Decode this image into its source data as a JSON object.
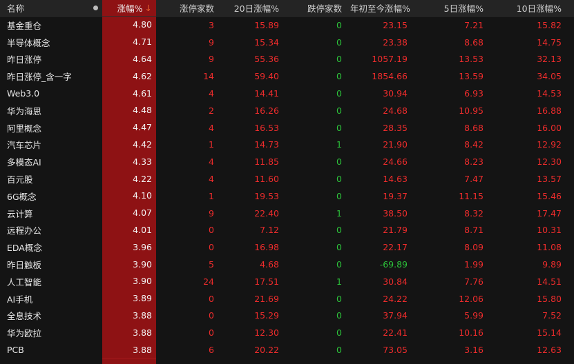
{
  "header": {
    "name": "名称",
    "change_pct": "涨幅%",
    "sort_indicator": "↓",
    "limit_up_count": "涨停家数",
    "change_20d": "20日涨幅%",
    "limit_down_count": "跌停家数",
    "change_ytd": "年初至今涨幅%",
    "change_5d": "5日涨幅%",
    "change_10d": "10日涨幅%"
  },
  "colors": {
    "up": "#ee2c2c",
    "down": "#2cc23a",
    "highlight_column": "#8e1214"
  },
  "rows": [
    {
      "name": "基金重仓",
      "chg": "4.80",
      "zt": "3",
      "c20": "15.89",
      "dt": "0",
      "ytd": "23.15",
      "c5": "7.21",
      "c10": "15.82"
    },
    {
      "name": "半导体概念",
      "chg": "4.71",
      "zt": "9",
      "c20": "15.34",
      "dt": "0",
      "ytd": "23.38",
      "c5": "8.68",
      "c10": "14.75"
    },
    {
      "name": "昨日涨停",
      "chg": "4.64",
      "zt": "9",
      "c20": "55.36",
      "dt": "0",
      "ytd": "1057.19",
      "c5": "13.53",
      "c10": "32.13"
    },
    {
      "name": "昨日涨停_含一字",
      "chg": "4.62",
      "zt": "14",
      "c20": "59.40",
      "dt": "0",
      "ytd": "1854.66",
      "c5": "13.59",
      "c10": "34.05"
    },
    {
      "name": "Web3.0",
      "chg": "4.61",
      "zt": "4",
      "c20": "14.41",
      "dt": "0",
      "ytd": "30.94",
      "c5": "6.93",
      "c10": "14.53"
    },
    {
      "name": "华为海思",
      "chg": "4.48",
      "zt": "2",
      "c20": "16.26",
      "dt": "0",
      "ytd": "24.68",
      "c5": "10.95",
      "c10": "16.88"
    },
    {
      "name": "阿里概念",
      "chg": "4.47",
      "zt": "4",
      "c20": "16.53",
      "dt": "0",
      "ytd": "28.35",
      "c5": "8.68",
      "c10": "16.00"
    },
    {
      "name": "汽车芯片",
      "chg": "4.42",
      "zt": "1",
      "c20": "14.73",
      "dt": "1",
      "ytd": "21.90",
      "c5": "8.42",
      "c10": "12.92"
    },
    {
      "name": "多模态AI",
      "chg": "4.33",
      "zt": "4",
      "c20": "11.85",
      "dt": "0",
      "ytd": "24.66",
      "c5": "8.23",
      "c10": "12.30"
    },
    {
      "name": "百元股",
      "chg": "4.22",
      "zt": "4",
      "c20": "11.60",
      "dt": "0",
      "ytd": "14.63",
      "c5": "7.47",
      "c10": "13.57"
    },
    {
      "name": "6G概念",
      "chg": "4.10",
      "zt": "1",
      "c20": "19.53",
      "dt": "0",
      "ytd": "19.37",
      "c5": "11.15",
      "c10": "15.46"
    },
    {
      "name": "云计算",
      "chg": "4.07",
      "zt": "9",
      "c20": "22.40",
      "dt": "1",
      "ytd": "38.50",
      "c5": "8.32",
      "c10": "17.47"
    },
    {
      "name": "远程办公",
      "chg": "4.01",
      "zt": "0",
      "c20": "7.12",
      "dt": "0",
      "ytd": "21.79",
      "c5": "8.71",
      "c10": "10.31"
    },
    {
      "name": "EDA概念",
      "chg": "3.96",
      "zt": "0",
      "c20": "16.98",
      "dt": "0",
      "ytd": "22.17",
      "c5": "8.09",
      "c10": "11.08"
    },
    {
      "name": "昨日触板",
      "chg": "3.90",
      "zt": "5",
      "c20": "4.68",
      "dt": "0",
      "ytd": "-69.89",
      "c5": "1.99",
      "c10": "9.89"
    },
    {
      "name": "人工智能",
      "chg": "3.90",
      "zt": "24",
      "c20": "17.51",
      "dt": "1",
      "ytd": "30.84",
      "c5": "7.76",
      "c10": "14.51"
    },
    {
      "name": "AI手机",
      "chg": "3.89",
      "zt": "0",
      "c20": "21.69",
      "dt": "0",
      "ytd": "24.22",
      "c5": "12.06",
      "c10": "15.80"
    },
    {
      "name": "全息技术",
      "chg": "3.88",
      "zt": "0",
      "c20": "15.29",
      "dt": "0",
      "ytd": "37.94",
      "c5": "5.99",
      "c10": "7.52"
    },
    {
      "name": "华为欧拉",
      "chg": "3.88",
      "zt": "0",
      "c20": "12.30",
      "dt": "0",
      "ytd": "22.41",
      "c5": "10.16",
      "c10": "15.14"
    },
    {
      "name": "PCB",
      "chg": "3.88",
      "zt": "6",
      "c20": "20.22",
      "dt": "0",
      "ytd": "73.05",
      "c5": "3.16",
      "c10": "12.63"
    }
  ]
}
